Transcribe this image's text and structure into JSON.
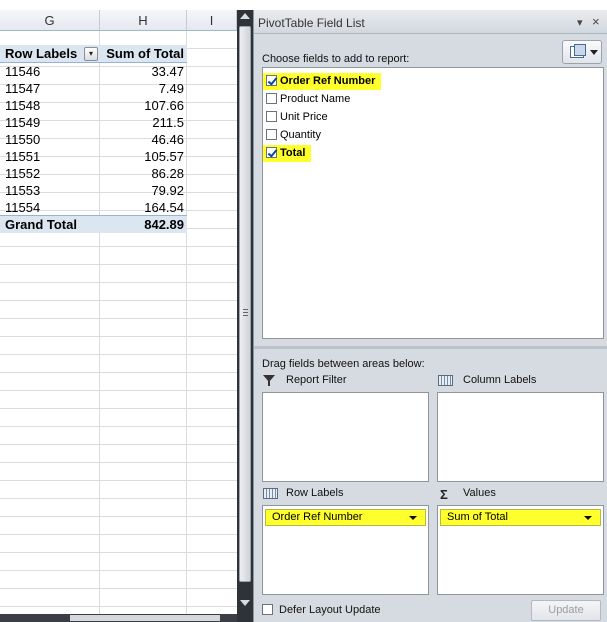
{
  "sheet": {
    "columns": [
      "G",
      "H",
      "I"
    ],
    "pivot": {
      "header": {
        "row_labels": "Row Labels",
        "sum_label": "Sum of Total",
        "filter_glyph": "▾"
      },
      "rows": [
        {
          "label": "11546",
          "value": "33.47"
        },
        {
          "label": "11547",
          "value": "7.49"
        },
        {
          "label": "11548",
          "value": "107.66"
        },
        {
          "label": "11549",
          "value": "211.5"
        },
        {
          "label": "11550",
          "value": "46.46"
        },
        {
          "label": "11551",
          "value": "105.57"
        },
        {
          "label": "11552",
          "value": "86.28"
        },
        {
          "label": "11553",
          "value": "79.92"
        },
        {
          "label": "11554",
          "value": "164.54"
        }
      ],
      "grand_total": {
        "label": "Grand Total",
        "value": "842.89"
      }
    }
  },
  "panel": {
    "title": "PivotTable Field List",
    "dropdown_glyph": "▾",
    "close_glyph": "×",
    "choose_label": "Choose fields to add to report:",
    "fields": [
      {
        "label": "Order Ref Number",
        "checked": true,
        "highlight": true
      },
      {
        "label": "Product Name",
        "checked": false,
        "highlight": false
      },
      {
        "label": "Unit Price",
        "checked": false,
        "highlight": false
      },
      {
        "label": "Quantity",
        "checked": false,
        "highlight": false
      },
      {
        "label": "Total",
        "checked": true,
        "highlight": true
      }
    ],
    "drag_label": "Drag fields between areas below:",
    "areas": {
      "report_filter": {
        "label": "Report Filter"
      },
      "column_labels": {
        "label": "Column Labels"
      },
      "row_labels": {
        "label": "Row Labels",
        "item": "Order Ref Number"
      },
      "values": {
        "label": "Values",
        "item": "Sum of Total",
        "icon_glyph": "Σ"
      }
    },
    "defer_label": "Defer Layout Update",
    "update_label": "Update",
    "highlight_color": "#ffff2e"
  }
}
